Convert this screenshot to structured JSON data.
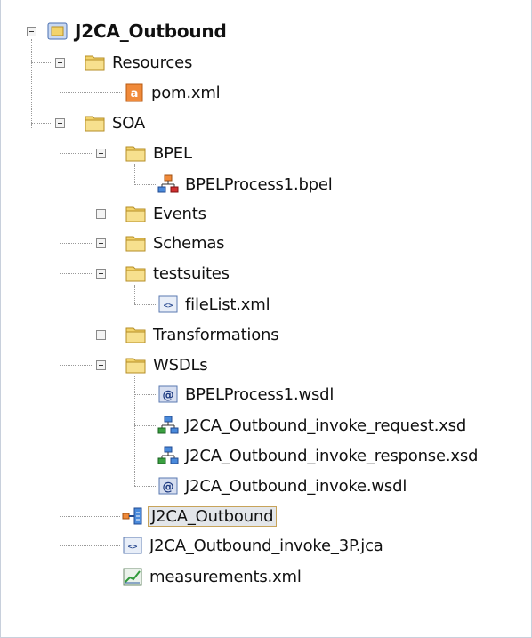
{
  "tree": {
    "root": "J2CA_Outbound",
    "resources": {
      "label": "Resources",
      "items": [
        "pom.xml"
      ]
    },
    "soa": {
      "label": "SOA",
      "bpel": {
        "label": "BPEL",
        "items": [
          "BPELProcess1.bpel"
        ]
      },
      "events": "Events",
      "schemas": "Schemas",
      "testsuites": {
        "label": "testsuites",
        "items": [
          "fileList.xml"
        ]
      },
      "transformations": "Transformations",
      "wsdls": {
        "label": "WSDLs",
        "items": [
          "BPELProcess1.wsdl",
          "J2CA_Outbound_invoke_request.xsd",
          "J2CA_Outbound_invoke_response.xsd",
          "J2CA_Outbound_invoke.wsdl"
        ]
      },
      "files": [
        "J2CA_Outbound",
        "J2CA_Outbound_invoke_3P.jca",
        "measurements.xml"
      ]
    },
    "selected_item": "J2CA_Outbound",
    "colors": {
      "folder": "#f2d36b",
      "selection_border": "#c7a35a",
      "connector": "#9a9a9a"
    }
  }
}
